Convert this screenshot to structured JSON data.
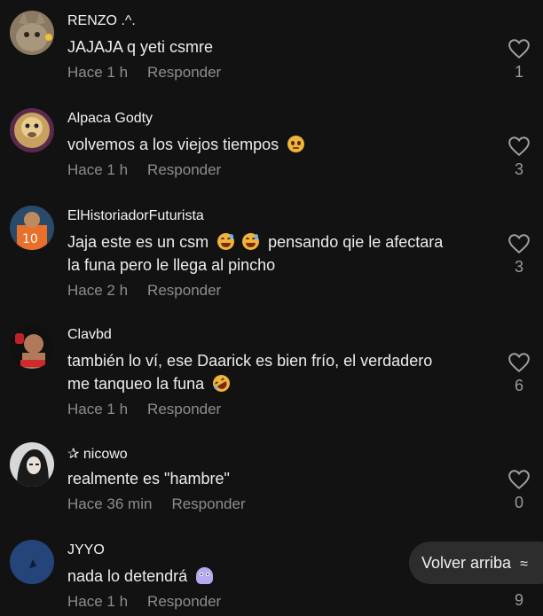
{
  "comments": [
    {
      "user": "RENZO .^.",
      "text": "JAJAJA q yeti csmre",
      "time": "Hace 1 h",
      "reply": "Responder",
      "likes": "1"
    },
    {
      "user": "Alpaca Godty",
      "text": "volvemos a los viejos tiempos",
      "time": "Hace 1 h",
      "reply": "Responder",
      "likes": "3",
      "emoji": "pleading-face"
    },
    {
      "user": "ElHistoriadorFuturista",
      "text_line1": "Jaja este es un csm",
      "text_line1b": "pensando qie le afectara",
      "text_line2": "la funa pero le llega al pincho",
      "time": "Hace 2 h",
      "reply": "Responder",
      "likes": "3",
      "emoji": "sweat-smile-face"
    },
    {
      "user": "Clavbd",
      "text_line1": "también lo ví, ese Daarick es bien frío, el verdadero",
      "text_line2": "me tanqueo la funa",
      "time": "Hace 1 h",
      "reply": "Responder",
      "likes": "6",
      "emoji": "rolling-laughing-face"
    },
    {
      "user": "nicowo",
      "user_prefix": "✰",
      "text": "realmente es \"hambre\"",
      "time": "Hace 36 min",
      "reply": "Responder",
      "likes": "0"
    },
    {
      "user": "JYYO",
      "text": "nada lo detendrá",
      "time": "Hace 1 h",
      "reply": "Responder",
      "likes": "9",
      "emoji": "ghost"
    }
  ],
  "volver": {
    "label": "Volver arriba",
    "icon": "chevron-up-icon"
  },
  "colors": {
    "background": "#121212",
    "muted": "#8d8d8d",
    "button": "#2d2d2d"
  }
}
